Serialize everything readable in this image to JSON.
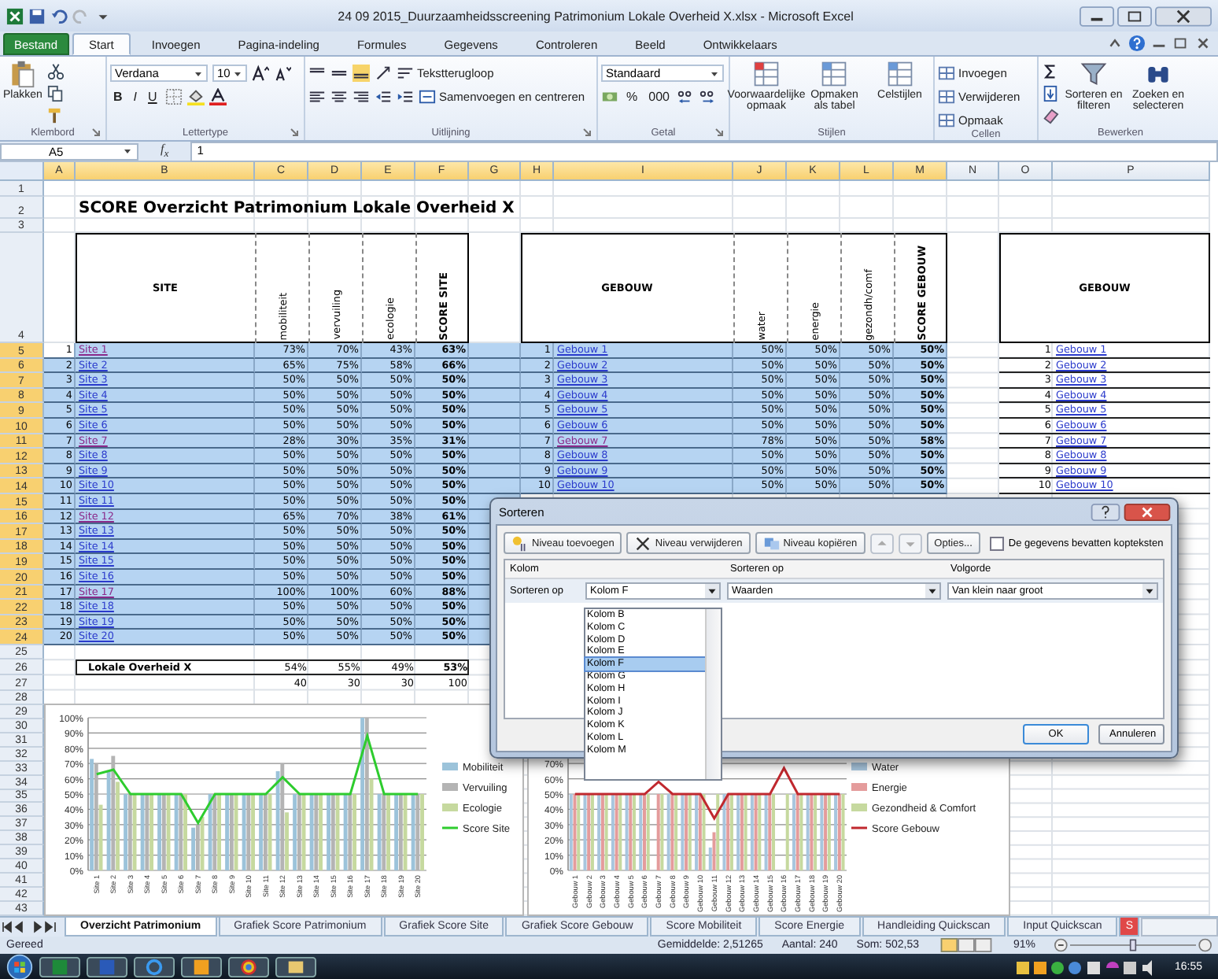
{
  "window": {
    "title": "24 09 2015_Duurzaamheidsscreening Patrimonium Lokale Overheid X.xlsx - Microsoft Excel"
  },
  "ribbon_tabs": [
    {
      "label": "Bestand",
      "kind": "file",
      "selected": false
    },
    {
      "label": "Start",
      "kind": "tab",
      "selected": true
    },
    {
      "label": "Invoegen",
      "kind": "tab",
      "selected": false
    },
    {
      "label": "Pagina-indeling",
      "kind": "tab",
      "selected": false
    },
    {
      "label": "Formules",
      "kind": "tab",
      "selected": false
    },
    {
      "label": "Gegevens",
      "kind": "tab",
      "selected": false
    },
    {
      "label": "Controleren",
      "kind": "tab",
      "selected": false
    },
    {
      "label": "Beeld",
      "kind": "tab",
      "selected": false
    },
    {
      "label": "Ontwikkelaars",
      "kind": "tab",
      "selected": false
    }
  ],
  "ribbon": {
    "clipboard": {
      "label": "Klembord",
      "paste": "Plakken"
    },
    "font": {
      "label": "Lettertype",
      "family": "Verdana",
      "size": "10",
      "bold": "B",
      "italic": "I",
      "underline": "U"
    },
    "alignment": {
      "label": "Uitlijning",
      "wrap": "Tekstterugloop",
      "merge": "Samenvoegen en centreren"
    },
    "number": {
      "label": "Getal",
      "format": "Standaard",
      "percent": "%",
      "thousands": "000"
    },
    "styles": {
      "label": "Stijlen",
      "buttons": [
        "Voorwaardelijke opmaak",
        "Opmaken als tabel",
        "Celstijlen"
      ]
    },
    "cells": {
      "label": "Cellen",
      "buttons": [
        "Invoegen",
        "Verwijderen",
        "Opmaak"
      ]
    },
    "editing": {
      "label": "Bewerken",
      "buttons": [
        "Sorteren en filteren",
        "Zoeken en selecteren"
      ]
    }
  },
  "formula_bar": {
    "name_box": "A5",
    "function_label": "f$_{x}$",
    "value": "1"
  },
  "sheet": {
    "columns": [
      "A",
      "B",
      "C",
      "D",
      "E",
      "F",
      "G",
      "H",
      "I",
      "J",
      "K",
      "L",
      "M",
      "N",
      "O",
      "P"
    ],
    "row_numbers": [
      "1",
      "2",
      "3",
      "4",
      "5",
      "6",
      "7",
      "8",
      "9",
      "10",
      "11",
      "12",
      "13",
      "14",
      "15",
      "16",
      "17",
      "18",
      "19",
      "20",
      "21",
      "22",
      "23",
      "24",
      "25",
      "26",
      "27",
      "28",
      "29",
      "30",
      "31",
      "32",
      "33",
      "34",
      "35",
      "36",
      "37",
      "38",
      "39",
      "40",
      "41",
      "42",
      "43"
    ],
    "title": "SCORE Overzicht Patrimonium Lokale Overheid X",
    "site_table": {
      "headers": [
        "SITE",
        "mobiliteit",
        "vervuiling",
        "ecologie",
        "SCORE SITE"
      ],
      "rows": [
        {
          "nr": "1",
          "name": "Site 1",
          "visited": true,
          "selected": true,
          "active": true,
          "values": [
            "73%",
            "70%",
            "43%",
            "63%"
          ]
        },
        {
          "nr": "2",
          "name": "Site 2",
          "visited": false,
          "selected": true,
          "active": false,
          "values": [
            "65%",
            "75%",
            "58%",
            "66%"
          ]
        },
        {
          "nr": "3",
          "name": "Site 3",
          "visited": false,
          "selected": true,
          "active": false,
          "values": [
            "50%",
            "50%",
            "50%",
            "50%"
          ]
        },
        {
          "nr": "4",
          "name": "Site 4",
          "visited": false,
          "selected": true,
          "active": false,
          "values": [
            "50%",
            "50%",
            "50%",
            "50%"
          ]
        },
        {
          "nr": "5",
          "name": "Site 5",
          "visited": false,
          "selected": true,
          "active": false,
          "values": [
            "50%",
            "50%",
            "50%",
            "50%"
          ]
        },
        {
          "nr": "6",
          "name": "Site 6",
          "visited": false,
          "selected": true,
          "active": false,
          "values": [
            "50%",
            "50%",
            "50%",
            "50%"
          ]
        },
        {
          "nr": "7",
          "name": "Site 7",
          "visited": true,
          "selected": true,
          "active": false,
          "values": [
            "28%",
            "30%",
            "35%",
            "31%"
          ]
        },
        {
          "nr": "8",
          "name": "Site 8",
          "visited": false,
          "selected": true,
          "active": false,
          "values": [
            "50%",
            "50%",
            "50%",
            "50%"
          ]
        },
        {
          "nr": "9",
          "name": "Site 9",
          "visited": false,
          "selected": true,
          "active": false,
          "values": [
            "50%",
            "50%",
            "50%",
            "50%"
          ]
        },
        {
          "nr": "10",
          "name": "Site 10",
          "visited": false,
          "selected": true,
          "active": false,
          "values": [
            "50%",
            "50%",
            "50%",
            "50%"
          ]
        },
        {
          "nr": "11",
          "name": "Site 11",
          "visited": false,
          "selected": true,
          "active": false,
          "values": [
            "50%",
            "50%",
            "50%",
            "50%"
          ]
        },
        {
          "nr": "12",
          "name": "Site 12",
          "visited": true,
          "selected": true,
          "active": false,
          "values": [
            "65%",
            "70%",
            "38%",
            "61%"
          ]
        },
        {
          "nr": "13",
          "name": "Site 13",
          "visited": false,
          "selected": true,
          "active": false,
          "values": [
            "50%",
            "50%",
            "50%",
            "50%"
          ]
        },
        {
          "nr": "14",
          "name": "Site 14",
          "visited": false,
          "selected": true,
          "active": false,
          "values": [
            "50%",
            "50%",
            "50%",
            "50%"
          ]
        },
        {
          "nr": "15",
          "name": "Site 15",
          "visited": false,
          "selected": true,
          "active": false,
          "values": [
            "50%",
            "50%",
            "50%",
            "50%"
          ]
        },
        {
          "nr": "16",
          "name": "Site 16",
          "visited": false,
          "selected": true,
          "active": false,
          "values": [
            "50%",
            "50%",
            "50%",
            "50%"
          ]
        },
        {
          "nr": "17",
          "name": "Site 17",
          "visited": true,
          "selected": true,
          "active": false,
          "values": [
            "100%",
            "100%",
            "60%",
            "88%"
          ]
        },
        {
          "nr": "18",
          "name": "Site 18",
          "visited": false,
          "selected": true,
          "active": false,
          "values": [
            "50%",
            "50%",
            "50%",
            "50%"
          ]
        },
        {
          "nr": "19",
          "name": "Site 19",
          "visited": false,
          "selected": true,
          "active": false,
          "values": [
            "50%",
            "50%",
            "50%",
            "50%"
          ]
        },
        {
          "nr": "20",
          "name": "Site 20",
          "visited": false,
          "selected": true,
          "active": false,
          "values": [
            "50%",
            "50%",
            "50%",
            "50%"
          ]
        }
      ],
      "total": {
        "label": "Lokale Overheid X",
        "values": [
          "54%",
          "55%",
          "49%",
          "53%"
        ]
      },
      "weights": [
        "40",
        "30",
        "30",
        "100"
      ]
    },
    "building_table": {
      "headers": [
        "GEBOUW",
        "water",
        "energie",
        "gezondh/comf",
        "SCORE GEBOUW"
      ],
      "rows": [
        {
          "nr": "1",
          "name": "Gebouw 1",
          "visited": false,
          "selected": true,
          "values": [
            "50%",
            "50%",
            "50%",
            "50%"
          ]
        },
        {
          "nr": "2",
          "name": "Gebouw 2",
          "visited": false,
          "selected": true,
          "values": [
            "50%",
            "50%",
            "50%",
            "50%"
          ]
        },
        {
          "nr": "3",
          "name": "Gebouw 3",
          "visited": false,
          "selected": true,
          "values": [
            "50%",
            "50%",
            "50%",
            "50%"
          ]
        },
        {
          "nr": "4",
          "name": "Gebouw 4",
          "visited": false,
          "selected": true,
          "values": [
            "50%",
            "50%",
            "50%",
            "50%"
          ]
        },
        {
          "nr": "5",
          "name": "Gebouw 5",
          "visited": false,
          "selected": true,
          "values": [
            "50%",
            "50%",
            "50%",
            "50%"
          ]
        },
        {
          "nr": "6",
          "name": "Gebouw 6",
          "visited": false,
          "selected": true,
          "values": [
            "50%",
            "50%",
            "50%",
            "50%"
          ]
        },
        {
          "nr": "7",
          "name": "Gebouw 7",
          "visited": true,
          "selected": true,
          "values": [
            "78%",
            "50%",
            "50%",
            "58%"
          ]
        },
        {
          "nr": "8",
          "name": "Gebouw 8",
          "visited": false,
          "selected": true,
          "values": [
            "50%",
            "50%",
            "50%",
            "50%"
          ]
        },
        {
          "nr": "9",
          "name": "Gebouw 9",
          "visited": false,
          "selected": true,
          "values": [
            "50%",
            "50%",
            "50%",
            "50%"
          ]
        },
        {
          "nr": "10",
          "name": "Gebouw 10",
          "visited": false,
          "selected": true,
          "values": [
            "50%",
            "50%",
            "50%",
            "50%"
          ]
        }
      ]
    },
    "building_list": {
      "header": "GEBOUW",
      "rows": [
        {
          "nr": "1",
          "name": "Gebouw 1"
        },
        {
          "nr": "2",
          "name": "Gebouw 2"
        },
        {
          "nr": "3",
          "name": "Gebouw 3"
        },
        {
          "nr": "4",
          "name": "Gebouw 4"
        },
        {
          "nr": "5",
          "name": "Gebouw 5"
        },
        {
          "nr": "6",
          "name": "Gebouw 6"
        },
        {
          "nr": "7",
          "name": "Gebouw 7"
        },
        {
          "nr": "8",
          "name": "Gebouw 8"
        },
        {
          "nr": "9",
          "name": "Gebouw 9"
        },
        {
          "nr": "10",
          "name": "Gebouw 10"
        }
      ]
    }
  },
  "charts": [
    {
      "chart_data": {
        "type": "bar",
        "grid": true,
        "legend": true,
        "categories": [
          "Site 1",
          "Site 2",
          "Site 3",
          "Site 4",
          "Site 5",
          "Site 6",
          "Site 7",
          "Site 8",
          "Site 9",
          "Site 10",
          "Site 11",
          "Site 12",
          "Site 13",
          "Site 14",
          "Site 15",
          "Site 16",
          "Site 17",
          "Site 18",
          "Site 19",
          "Site 20"
        ],
        "ylim": [
          0,
          100
        ],
        "yticks": [
          {
            "value": 0,
            "label": "0%"
          },
          {
            "value": 10,
            "label": "10%"
          },
          {
            "value": 20,
            "label": "20%"
          },
          {
            "value": 30,
            "label": "30%"
          },
          {
            "value": 40,
            "label": "40%"
          },
          {
            "value": 50,
            "label": "50%"
          },
          {
            "value": 60,
            "label": "60%"
          },
          {
            "value": 70,
            "label": "70%"
          },
          {
            "value": 80,
            "label": "80%"
          },
          {
            "value": 90,
            "label": "90%"
          },
          {
            "value": 100,
            "label": "100%"
          }
        ],
        "series": [
          {
            "name": "Mobiliteit",
            "type": "bar",
            "color": "#9cc3da",
            "values": [
              73,
              65,
              50,
              50,
              50,
              50,
              28,
              50,
              50,
              50,
              50,
              65,
              50,
              50,
              50,
              50,
              100,
              50,
              50,
              50
            ]
          },
          {
            "name": "Vervuiling",
            "type": "bar",
            "color": "#b4b4b4",
            "values": [
              70,
              75,
              50,
              50,
              50,
              50,
              30,
              50,
              50,
              50,
              50,
              70,
              50,
              50,
              50,
              50,
              100,
              50,
              50,
              50
            ]
          },
          {
            "name": "Ecologie",
            "type": "bar",
            "color": "#c6d99f",
            "values": [
              43,
              58,
              50,
              50,
              50,
              50,
              35,
              50,
              50,
              50,
              50,
              38,
              50,
              50,
              50,
              50,
              60,
              50,
              50,
              50
            ]
          },
          {
            "name": "Score Site",
            "type": "line",
            "color": "#2ecc2e",
            "values": [
              63,
              66,
              50,
              50,
              50,
              50,
              31,
              50,
              50,
              50,
              50,
              61,
              50,
              50,
              50,
              50,
              88,
              50,
              50,
              50
            ]
          }
        ]
      }
    },
    {
      "chart_data": {
        "type": "bar",
        "grid": true,
        "legend": true,
        "categories": [
          "Gebouw 1",
          "Gebouw 2",
          "Gebouw 3",
          "Gebouw 4",
          "Gebouw 5",
          "Gebouw 6",
          "Gebouw 7",
          "Gebouw 8",
          "Gebouw 9",
          "Gebouw 10",
          "Gebouw 11",
          "Gebouw 12",
          "Gebouw 13",
          "Gebouw 14",
          "Gebouw 15",
          "Gebouw 16",
          "Gebouw 17",
          "Gebouw 18",
          "Gebouw 19",
          "Gebouw 20"
        ],
        "ylim": [
          0,
          100
        ],
        "yticks": [
          {
            "value": 0,
            "label": "0%"
          },
          {
            "value": 10,
            "label": "10%"
          },
          {
            "value": 20,
            "label": "20%"
          },
          {
            "value": 30,
            "label": "30%"
          },
          {
            "value": 40,
            "label": "40%"
          },
          {
            "value": 50,
            "label": "50%"
          },
          {
            "value": 60,
            "label": "60%"
          },
          {
            "value": 70,
            "label": "70%"
          }
        ],
        "series": [
          {
            "name": "Water",
            "type": "bar",
            "color": "#a8c6de",
            "values": [
              50,
              50,
              50,
              50,
              50,
              50,
              null,
              50,
              50,
              50,
              15,
              50,
              50,
              50,
              50,
              null,
              50,
              50,
              50,
              50
            ]
          },
          {
            "name": "Energie",
            "type": "bar",
            "color": "#e49c9c",
            "values": [
              50,
              50,
              50,
              50,
              50,
              50,
              50,
              50,
              50,
              50,
              25,
              50,
              50,
              50,
              50,
              null,
              50,
              50,
              50,
              50
            ]
          },
          {
            "name": "Gezondheid & Comfort",
            "type": "bar",
            "color": "#c6d99f",
            "values": [
              50,
              50,
              50,
              50,
              50,
              50,
              50,
              50,
              50,
              50,
              50,
              50,
              50,
              50,
              50,
              50,
              50,
              50,
              50,
              50
            ]
          },
          {
            "name": "Score Gebouw",
            "type": "line",
            "color": "#c0282e",
            "values": [
              50,
              50,
              50,
              50,
              50,
              50,
              58,
              50,
              50,
              50,
              34,
              50,
              50,
              50,
              50,
              67,
              50,
              50,
              50,
              50
            ]
          }
        ]
      }
    }
  ],
  "dialog": {
    "title": "Sorteren",
    "toolbar": [
      "Niveau toevoegen",
      "Niveau verwijderen",
      "Niveau kopiëren",
      "Opties..."
    ],
    "headers_checkbox": {
      "label": "De gegevens bevatten kopteksten",
      "checked": false
    },
    "columns": [
      "Kolom",
      "Sorteren op",
      "Volgorde"
    ],
    "row_label": "Sorteren op",
    "column_value": "Kolom F",
    "sort_on": "Waarden",
    "order": "Van klein naar groot",
    "dropdown_items": [
      {
        "label": "Kolom B",
        "selected": false
      },
      {
        "label": "Kolom C",
        "selected": false
      },
      {
        "label": "Kolom D",
        "selected": false
      },
      {
        "label": "Kolom E",
        "selected": false
      },
      {
        "label": "Kolom F",
        "selected": true
      },
      {
        "label": "Kolom G",
        "selected": false
      },
      {
        "label": "Kolom H",
        "selected": false
      },
      {
        "label": "Kolom I",
        "selected": false
      },
      {
        "label": "Kolom J",
        "selected": false
      },
      {
        "label": "Kolom K",
        "selected": false
      },
      {
        "label": "Kolom L",
        "selected": false
      },
      {
        "label": "Kolom M",
        "selected": false
      }
    ],
    "buttons": [
      "OK",
      "Annuleren"
    ]
  },
  "sheet_tabs": [
    {
      "label": "Overzicht Patrimonium",
      "selected": true
    },
    {
      "label": "Grafiek Score Patrimonium",
      "selected": false
    },
    {
      "label": "Grafiek Score Site",
      "selected": false
    },
    {
      "label": "Grafiek Score Gebouw",
      "selected": false
    },
    {
      "label": "Score Mobiliteit",
      "selected": false
    },
    {
      "label": "Score Energie",
      "selected": false
    },
    {
      "label": "Handleiding Quickscan",
      "selected": false
    },
    {
      "label": "Input Quickscan",
      "selected": false
    },
    {
      "label": "S",
      "selected": false,
      "color": "#e04848"
    }
  ],
  "status_bar": {
    "status": "Gereed",
    "average": "Gemiddelde: 2,51265",
    "count": "Aantal: 240",
    "sum": "Som: 502,53",
    "zoom": "91%",
    "zoom_slider": {
      "level": 0.5
    }
  },
  "taskbar": {
    "time": "16:55"
  }
}
